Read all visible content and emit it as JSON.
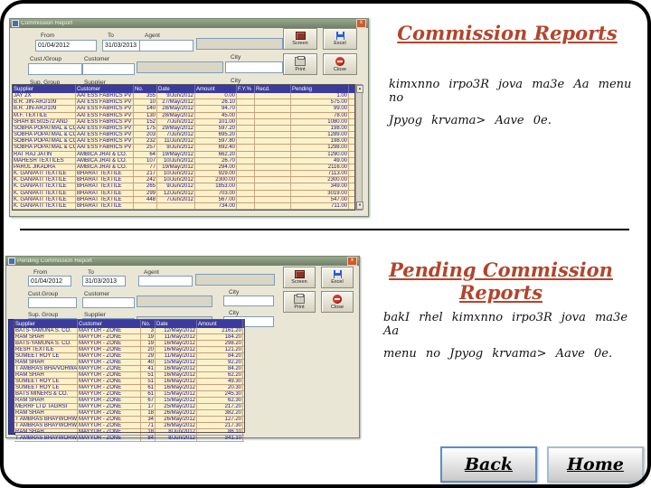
{
  "colors": {
    "accent_heading": "#B2452C",
    "grid_header": "#3B3B9E",
    "grid_row_bg": "#FBF2CC",
    "grid_text": "#14148C",
    "titlebar": "#7E9072",
    "close_button": "#CC5C33"
  },
  "section1": {
    "title": "Commission Reports",
    "lines": [
      "kimxnno  irpo3R  jova  ma3e  Aa  menu  no",
      "Jpyog krvama> Aave 0e."
    ]
  },
  "section2": {
    "title": "Pending Commission Reports",
    "lines": [
      "bakI  rhel  kimxnno  irpo3R  jova  ma3e  Aa",
      "menu no Jpyog krvama> Aave 0e."
    ]
  },
  "nav": {
    "back": "Back",
    "home": "Home"
  },
  "window1": {
    "title": "Commission Report",
    "close_glyph": "x",
    "fields": {
      "from": {
        "label": "From",
        "value": "01/04/2012"
      },
      "to": {
        "label": "To",
        "value": "31/03/2013"
      },
      "agent": {
        "label": "Agent",
        "value": ""
      },
      "cust_group": {
        "label": "Cust./Group",
        "value": ""
      },
      "customer": {
        "label": "Customer",
        "value": ""
      },
      "city1": {
        "label": "City",
        "value": ""
      },
      "sup_group": {
        "label": "Sup. Group",
        "value": ""
      },
      "supplier": {
        "label": "Supplier",
        "value": ""
      },
      "city2": {
        "label": "City",
        "value": ""
      }
    },
    "buttons": {
      "screen": "Screen",
      "excel": "Excel",
      "print": "Print",
      "close": "Close"
    },
    "grid": {
      "columns": [
        "Supplier",
        "Customer",
        "No.",
        "Date",
        "Amount",
        "F.Y.%",
        "Recd.",
        "Pending"
      ],
      "rows": [
        [
          "JAY 2X",
          "AAI ESS FABRICS PVT. LTD.",
          "355",
          "9/Jun/2012",
          "0.00",
          "",
          "",
          "1.00"
        ],
        [
          "B.R. JIN-ARJ/109",
          "AAI ESS FABRICS PVT. LTD.",
          "10",
          "27/May/2012",
          "26.10",
          "",
          "",
          "575.00"
        ],
        [
          "B.R. JIN-ARJ/109",
          "AAI ESS FABRICS PVT. LTD.",
          "140",
          "28/May/2012",
          "94.70",
          "",
          "",
          "99.00"
        ],
        [
          "M.F. TEXTILE",
          "AAI ESS FABRICS PVT. LTD.",
          "130",
          "28/May/2012",
          "45.00",
          "",
          "",
          "78.00"
        ],
        [
          "SHAH BI.502572 AND",
          "AAI ESS FABRICS PVT. LTD.",
          "152",
          "7/Jun/2012",
          "101.00",
          "",
          "",
          "1080.00"
        ],
        [
          "SOBHA POPATMAL & CO",
          "AAI ESS FABRICS PVT. LTD.",
          "175",
          "29/May/2012",
          "597.20",
          "",
          "",
          "198.00"
        ],
        [
          "SOBHA POPATMAL & CO",
          "AAI ESS FABRICS PVT. LTD.",
          "203",
          "7/Jun/2012",
          "695.20",
          "",
          "",
          "1289.00"
        ],
        [
          "SOBHA POPATMAL & CO",
          "AAI ESS FABRICS PVT. LTD.",
          "232",
          "11/Jun/2012",
          "597.80",
          "",
          "",
          "198.00"
        ],
        [
          "SOBHA POPATMAL & CO",
          "AAI ESS FABRICS PVT. LTD.",
          "257",
          "9/Jun/2012",
          "692.40",
          "",
          "",
          "1298.00"
        ],
        [
          "RAT RAJ JATIN",
          "AMBICA JRAI & CO.",
          "64",
          "19/May/2012",
          "662.20",
          "",
          "",
          "1290.00"
        ],
        [
          "MAHESH TEXTILES",
          "AMBICA JRAI & CO.",
          "107",
          "10/Jun/2012",
          "26.70",
          "",
          "",
          "49.00"
        ],
        [
          "PARUL JIKADRA",
          "AMBICA JRAI & CO.",
          "77",
          "19/May/2012",
          "294.00",
          "",
          "",
          "2116.00"
        ],
        [
          "K. GANPATI TEXTILE",
          "BHARAT TEXTILE",
          "217",
          "10/Jun/2012",
          "929.00",
          "",
          "",
          "7113.00"
        ],
        [
          "K. GANPATI TEXTILE",
          "BHARAT TEXTILE",
          "242",
          "10/Jun/2012",
          "2300.00",
          "",
          "",
          "2300.00"
        ],
        [
          "K. GANPATI TEXTILE",
          "BHARAT TEXTILE",
          "265",
          "9/Jun/2012",
          "1853.00",
          "",
          "",
          "349.00"
        ],
        [
          "K. GANPATI TEXTILE",
          "BHARAT TEXTILE",
          "299",
          "12/Jun/2012",
          "703.00",
          "",
          "",
          "3019.00"
        ],
        [
          "K. GANPATI TEXTILE",
          "BHARAT TEXTILE",
          "448",
          "7/Jun/2012",
          "567.00",
          "",
          "",
          "547.00"
        ],
        [
          "K. GANPATI TEXTILE",
          "BHARAT TEXTILE",
          "",
          "",
          "734.00",
          "",
          "",
          "711.00"
        ]
      ]
    }
  },
  "window2": {
    "title": "Pending Commission Report",
    "close_glyph": "x",
    "fields": {
      "from": {
        "label": "From",
        "value": "01/04/2012"
      },
      "to": {
        "label": "To",
        "value": "31/03/2013"
      },
      "agent": {
        "label": "Agent",
        "value": ""
      },
      "cust_group": {
        "label": "Cust.Group",
        "value": ""
      },
      "customer": {
        "label": "Customer",
        "value": ""
      },
      "city1": {
        "label": "City",
        "value": ""
      },
      "sup_group": {
        "label": "Sup. Group",
        "value": ""
      },
      "supplier": {
        "label": "Supplier",
        "value": ""
      },
      "city2": {
        "label": "City",
        "value": ""
      }
    },
    "buttons": {
      "screen": "Screen",
      "excel": "Excel",
      "print": "Print",
      "close": "Close"
    },
    "grid": {
      "columns": [
        "Supplier",
        "Customer",
        "No.",
        "Date",
        "Amount"
      ],
      "rows": [
        [
          "BATS-YAMUNA S. CO.",
          "MAYYUR - ZONE",
          "3",
          "12/May/2012",
          "2161.20"
        ],
        [
          "RAM SHAH",
          "MAYYUR - ZONE",
          "19",
          "11/May/2012",
          "184.20"
        ],
        [
          "BATS-YAMUNA S. CO.",
          "MAYYUR - ZONE",
          "19",
          "16/May/2012",
          "298.20"
        ],
        [
          "RESH TEXTILE",
          "MAYYUR - ZONE",
          "20",
          "16/May/2012",
          "121.20"
        ],
        [
          "SUMEET ROY LE",
          "MAYYUR - ZONE",
          "29",
          "11/May/2012",
          "84.20"
        ],
        [
          "RAM SHAH",
          "MAYYUR - ZONE",
          "40",
          "15/May/2012",
          "92.20"
        ],
        [
          "T AMBRAS BHA/VORWAS",
          "MAYYUR - ZONE",
          "41",
          "16/May/2012",
          "84.20"
        ],
        [
          "RAM SHAH",
          "MAYYUR - ZONE",
          "51",
          "16/May/2012",
          "62.20"
        ],
        [
          "SUMEET ROY LE",
          "MAYYUR - ZONE",
          "51",
          "16/May/2012",
          "49.30"
        ],
        [
          "SUMEET ROY LE",
          "MAYYUR - ZONE",
          "61",
          "16/May/2012",
          "20.30"
        ],
        [
          "BATS MINERS & CO.",
          "MAYYUR - ZONE",
          "61",
          "15/May/2012",
          "245.30"
        ],
        [
          "RAM SHAH",
          "MAYYUR - ZONE",
          "67",
          "15/May/2012",
          "62.30"
        ],
        [
          "MERRF LTD TAGRSI",
          "MAYYUR - ZONE",
          "17",
          "25/May/2012",
          "217.20"
        ],
        [
          "RAM SHAH",
          "MAYYUR - ZONE",
          "18",
          "26/May/2012",
          "382.20"
        ],
        [
          "T AMBRAS BHAYWORWAS",
          "MAYYUR - ZONE",
          "34",
          "26/May/2012",
          "127.20"
        ],
        [
          "T AMBRAS BHAYWORWAS",
          "MAYYUR - ZONE",
          "71",
          "26/May/2012",
          "217.30"
        ],
        [
          "RAM SHAH",
          "MAYYUR - ZONE",
          "18",
          "8/Jun/2012",
          "86.10"
        ],
        [
          "T AMBRAS BHAYWORWAS",
          "MAYYUR - ZONE",
          "84",
          "8/Jun/2012",
          "341.10"
        ]
      ]
    }
  }
}
